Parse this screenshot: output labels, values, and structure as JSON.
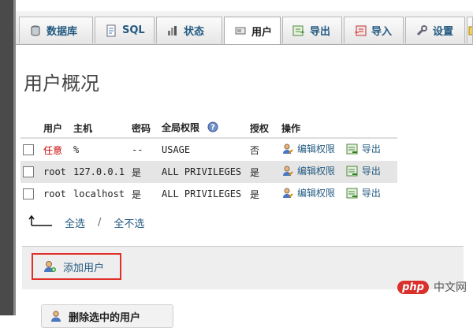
{
  "tabs": [
    {
      "label": "数据库",
      "icon": "database-icon"
    },
    {
      "label": "SQL",
      "icon": "sql-icon"
    },
    {
      "label": "状态",
      "icon": "status-icon"
    },
    {
      "label": "用户",
      "icon": "users-icon",
      "active": true
    },
    {
      "label": "导出",
      "icon": "export-icon"
    },
    {
      "label": "导入",
      "icon": "import-icon"
    },
    {
      "label": "设置",
      "icon": "settings-icon"
    }
  ],
  "page_title": "用户概况",
  "table": {
    "headers": {
      "user": "用户",
      "host": "主机",
      "password": "密码",
      "global_privileges": "全局权限",
      "grant": "授权",
      "action": "操作"
    },
    "rows": [
      {
        "user": "任意",
        "host": "%",
        "password": "--",
        "privileges": "USAGE",
        "grant": "否",
        "edit": "编辑权限",
        "export": "导出"
      },
      {
        "user": "root",
        "host": "127.0.0.1",
        "password": "是",
        "privileges": "ALL PRIVILEGES",
        "grant": "是",
        "edit": "编辑权限",
        "export": "导出"
      },
      {
        "user": "root",
        "host": "localhost",
        "password": "是",
        "privileges": "ALL PRIVILEGES",
        "grant": "是",
        "edit": "编辑权限",
        "export": "导出"
      }
    ]
  },
  "check_all": {
    "select_all": "全选",
    "separator": "/",
    "select_none": "全不选"
  },
  "add_user": {
    "label": "添加用户"
  },
  "delete_selected": {
    "label": "删除选中的用户"
  },
  "watermark": {
    "logo": "php",
    "text": "中文网"
  },
  "colors": {
    "link": "#235a81",
    "highlight_border": "#e0302a",
    "any_user": "#cc0000"
  }
}
